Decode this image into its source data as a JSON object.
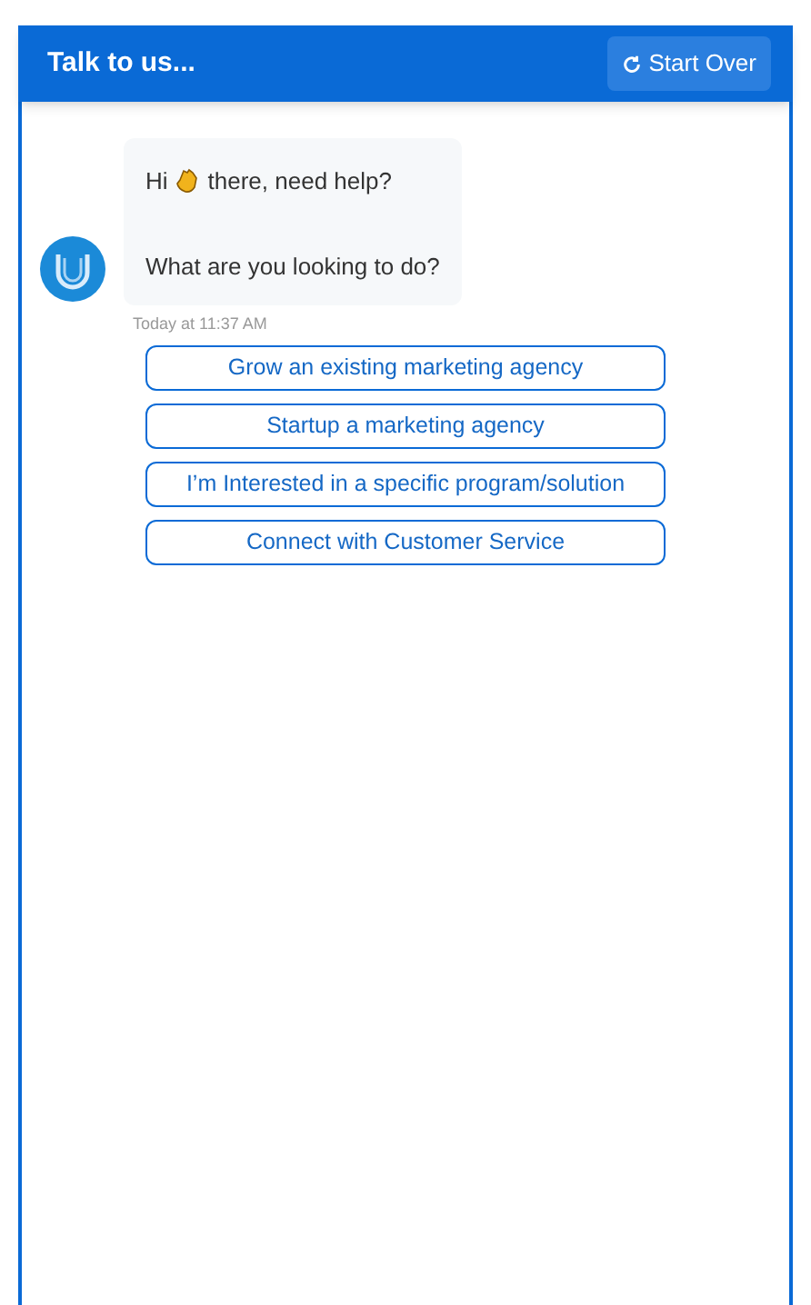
{
  "header": {
    "title": "Talk to us...",
    "start_over": "Start Over"
  },
  "message": {
    "greeting_before": "Hi",
    "greeting_after": "there, need help?",
    "question": "What are you looking to do?",
    "time": "Today at 11:37 AM"
  },
  "options": [
    "Grow an existing marketing agency",
    "Startup a marketing agency",
    "I’m Interested in a specific program/solution",
    "Connect with Customer Service"
  ]
}
